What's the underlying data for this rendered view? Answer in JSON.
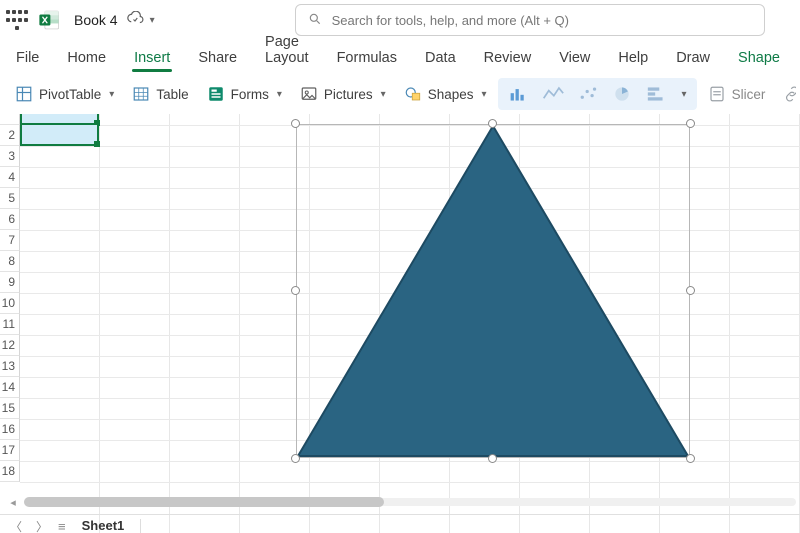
{
  "titlebar": {
    "book_name": "Book 4",
    "search_placeholder": "Search for tools, help, and more (Alt + Q)"
  },
  "tabs": {
    "file": "File",
    "home": "Home",
    "insert": "Insert",
    "share": "Share",
    "page_layout": "Page Layout",
    "formulas": "Formulas",
    "data": "Data",
    "review": "Review",
    "view": "View",
    "help": "Help",
    "draw": "Draw",
    "shape": "Shape"
  },
  "toolbar": {
    "pivot_table": "PivotTable",
    "table": "Table",
    "forms": "Forms",
    "pictures": "Pictures",
    "shapes": "Shapes",
    "slicer": "Slicer",
    "link": "Link"
  },
  "rows": [
    "2",
    "3",
    "4",
    "5",
    "6",
    "7",
    "8",
    "9",
    "10",
    "11",
    "12",
    "13",
    "14",
    "15",
    "16",
    "17",
    "18"
  ],
  "sheetbar": {
    "sheet1": "Sheet1"
  },
  "shape": {
    "fill": "#2a6482",
    "stroke": "#1d4a62"
  }
}
